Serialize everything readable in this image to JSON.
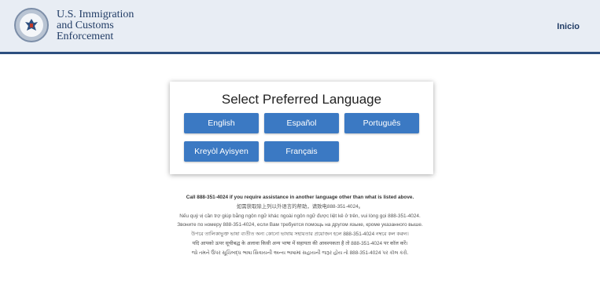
{
  "header": {
    "org_line1": "U.S. Immigration",
    "org_line2": "and Customs",
    "org_line3": "Enforcement",
    "nav_link": "Inicio",
    "seal_icon": "dhs-seal-icon"
  },
  "language_card": {
    "title": "Select Preferred Language",
    "buttons": [
      "English",
      "Español",
      "Português",
      "Kreyòl Ayisyen",
      "Français"
    ]
  },
  "assistance": {
    "lines": [
      "Call 888-351-4024 if you require assistance in another language other than what is listed above.",
      "如需获取除上列以外语言的帮助，请致电888-351-4024。",
      "Nếu quý vị cần trợ giúp bằng ngôn ngữ khác ngoài ngôn ngữ được liệt kê ở trên, vui lòng gọi 888-351-4024.",
      "Звоните по номеру 888-351-4024, если Вам требуется помощь на другом языке, кроме указанного выше.",
      "উপরে তালিকাভুক্ত ভাষা ব্যতীত অন্য কোনো ভাষায় সহায়তার প্রয়োজন হলে 888-351-4024 নম্বরে কল করুন।",
      "यदि आपको ऊपर सूचीबद्ध के अलावा किसी अन्य भाषा में सहायता की आवश्यकता है तो 888-351-4024 पर कॉल करें।",
      "જો તમને ઉપર સૂચિબદ્ધ ભાષા સિવાયની અન્ય ભાષામાં સહાયની જરૂર હોય તો 888-351-4024 પર કૉલ કરો."
    ]
  },
  "colors": {
    "header_bg": "#e8edf4",
    "header_border": "#2d4f7f",
    "button_bg": "#3b79c3",
    "title_text": "#223d66"
  }
}
